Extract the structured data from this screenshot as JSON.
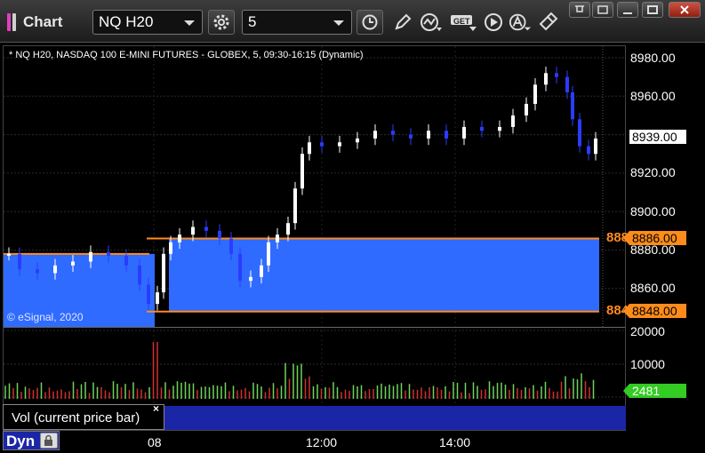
{
  "app": {
    "title": "Chart"
  },
  "toolbar": {
    "symbol": "NQ H20",
    "interval": "5",
    "get_label": "GET"
  },
  "chart": {
    "header": "* NQ H20, NASDAQ 100 E-MINI FUTURES - GLOBEX, 5, 09:30-16:15 (Dynamic)",
    "copyright": "© eSignal, 2020",
    "price_axis": [
      "8980.00",
      "8960.00",
      "8920.00",
      "8900.00",
      "8880.00",
      "8860.00"
    ],
    "current_price": "8939.00",
    "upper_level": {
      "label": "8886.00",
      "edge_text": "8886.00"
    },
    "lower_level": {
      "label": "8848.00",
      "edge_text": "8848.00"
    },
    "time_axis": [
      "08",
      "12:00",
      "14:00"
    ],
    "colors": {
      "up": "#ffffff",
      "down": "#2a3cff",
      "band": "#2f6bff",
      "level_line": "#ff8c1a",
      "vol_up": "#6fd35a",
      "vol_down": "#d03030",
      "vol_tag": "#33cc22"
    }
  },
  "volume": {
    "axis": [
      "20000",
      "10000"
    ],
    "current": "2481",
    "panel_label": "Vol (current price bar)"
  },
  "footer": {
    "mode": "Dyn"
  }
}
